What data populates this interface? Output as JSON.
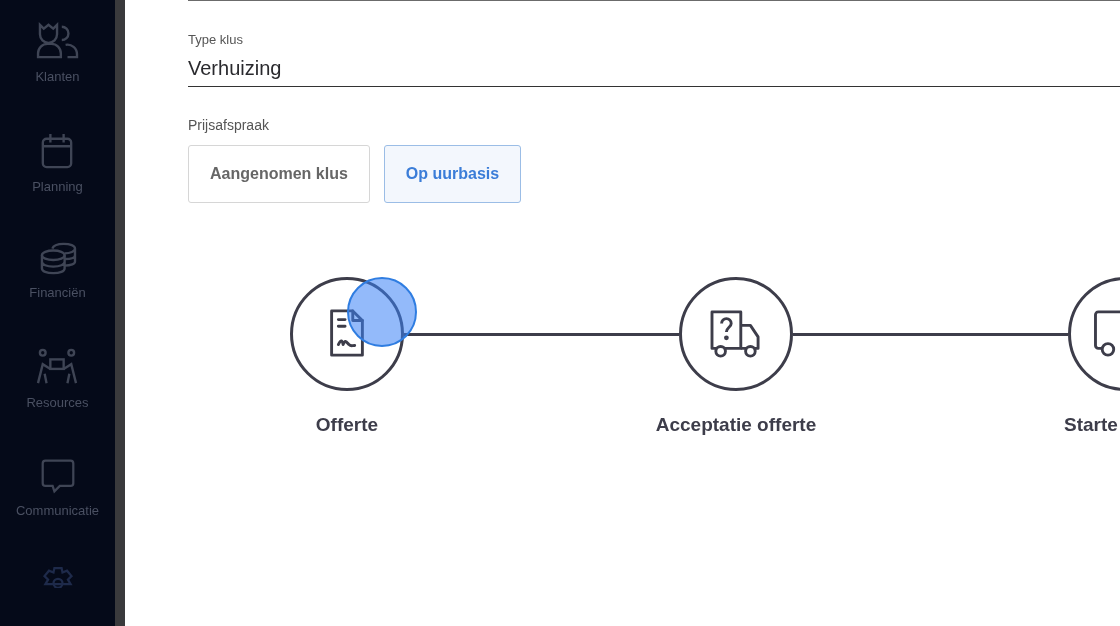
{
  "sidebar": {
    "items": [
      {
        "label": "Klanten"
      },
      {
        "label": "Planning"
      },
      {
        "label": "Financiën"
      },
      {
        "label": "Resources"
      },
      {
        "label": "Communicatie"
      }
    ]
  },
  "form": {
    "job_type": {
      "label": "Type klus",
      "value": "Verhuizing"
    },
    "pricing": {
      "label": "Prijsafspraak",
      "options": [
        {
          "label": "Aangenomen klus",
          "selected": false
        },
        {
          "label": "Op uurbasis",
          "selected": true
        }
      ]
    }
  },
  "steps": [
    {
      "label": "Offerte"
    },
    {
      "label": "Acceptatie offerte"
    },
    {
      "label": "Starte"
    }
  ]
}
